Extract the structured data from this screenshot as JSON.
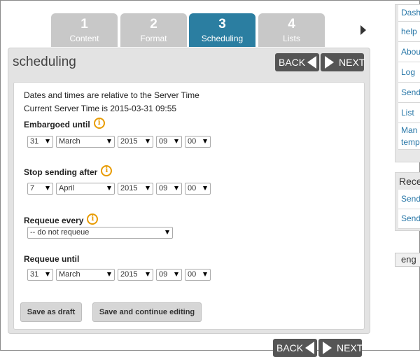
{
  "tabs": [
    {
      "num": "1",
      "label": "Content",
      "active": false
    },
    {
      "num": "2",
      "label": "Format",
      "active": false
    },
    {
      "num": "3",
      "label": "Scheduling",
      "active": true
    },
    {
      "num": "4",
      "label": "Lists",
      "active": false
    }
  ],
  "panel": {
    "title": "scheduling",
    "back_label": "BACK",
    "next_label": "NEXT"
  },
  "info": {
    "line1": "Dates and times are relative to the Server Time",
    "line2": "Current Server Time is 2015-03-31 09:55"
  },
  "embargoed": {
    "title": "Embargoed until",
    "day": "31",
    "month": "March",
    "year": "2015",
    "hour": "09",
    "minute": "00"
  },
  "stop_sending": {
    "title": "Stop sending after",
    "day": "7",
    "month": "April",
    "year": "2015",
    "hour": "09",
    "minute": "00"
  },
  "requeue_every": {
    "title": "Requeue every",
    "value": "-- do not requeue"
  },
  "requeue_until": {
    "title": "Requeue until",
    "day": "31",
    "month": "March",
    "year": "2015",
    "hour": "09",
    "minute": "00"
  },
  "buttons": {
    "save_draft": "Save as draft",
    "save_continue": "Save and continue editing"
  },
  "sidebar": {
    "items": [
      "Dash",
      "help",
      "Abou",
      "Log",
      "Send",
      "List",
      "Man",
      "temp"
    ],
    "recent_head": "Rece",
    "recent_items": [
      "Send",
      "Send"
    ],
    "language": "eng"
  },
  "colors": {
    "active_tab": "#2b7ea1",
    "inactive_tab": "#c8c8c8",
    "nav_button": "#555555",
    "info_icon": "#e89b00",
    "link": "#2a78a8"
  }
}
